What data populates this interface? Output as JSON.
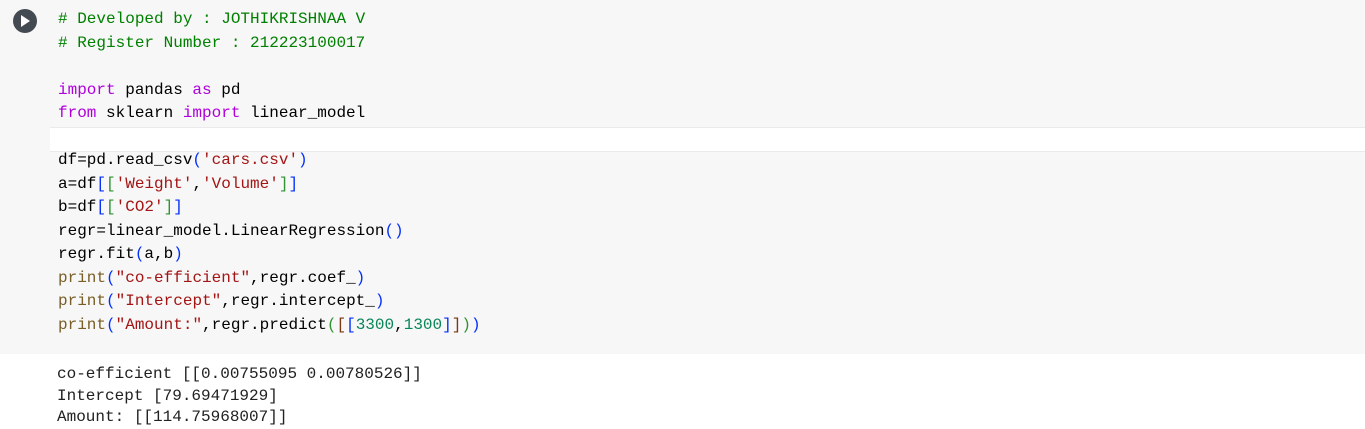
{
  "cell": {
    "run_button_icon": "play-icon",
    "code_lines": [
      [
        {
          "t": "# Developed by : JOTHIKRISHNAA V",
          "c": "cm"
        }
      ],
      [
        {
          "t": "# Register Number : 212223100017",
          "c": "cm"
        }
      ],
      [],
      [
        {
          "t": "import",
          "c": "kw"
        },
        {
          "t": " pandas "
        },
        {
          "t": "as",
          "c": "kw"
        },
        {
          "t": " pd"
        }
      ],
      [
        {
          "t": "from",
          "c": "kw"
        },
        {
          "t": " sklearn "
        },
        {
          "t": "import",
          "c": "kw"
        },
        {
          "t": " linear_model"
        }
      ],
      [],
      [
        {
          "t": "df=pd.read_csv"
        },
        {
          "t": "(",
          "c": "b1"
        },
        {
          "t": "'cars.csv'",
          "c": "st"
        },
        {
          "t": ")",
          "c": "b1"
        }
      ],
      [
        {
          "t": "a=df"
        },
        {
          "t": "[",
          "c": "b1"
        },
        {
          "t": "[",
          "c": "b2"
        },
        {
          "t": "'Weight'",
          "c": "st"
        },
        {
          "t": ","
        },
        {
          "t": "'Volume'",
          "c": "st"
        },
        {
          "t": "]",
          "c": "b2"
        },
        {
          "t": "]",
          "c": "b1"
        }
      ],
      [
        {
          "t": "b=df"
        },
        {
          "t": "[",
          "c": "b1"
        },
        {
          "t": "[",
          "c": "b2"
        },
        {
          "t": "'CO2'",
          "c": "st"
        },
        {
          "t": "]",
          "c": "b2"
        },
        {
          "t": "]",
          "c": "b1"
        }
      ],
      [
        {
          "t": "regr=linear_model.LinearRegression"
        },
        {
          "t": "()",
          "c": "b1"
        }
      ],
      [
        {
          "t": "regr.fit"
        },
        {
          "t": "(",
          "c": "b1"
        },
        {
          "t": "a,b"
        },
        {
          "t": ")",
          "c": "b1"
        }
      ],
      [
        {
          "t": "print",
          "c": "fn"
        },
        {
          "t": "(",
          "c": "b1"
        },
        {
          "t": "\"co-efficient\"",
          "c": "st"
        },
        {
          "t": ",regr.coef_"
        },
        {
          "t": ")",
          "c": "b1"
        }
      ],
      [
        {
          "t": "print",
          "c": "fn"
        },
        {
          "t": "(",
          "c": "b1"
        },
        {
          "t": "\"Intercept\"",
          "c": "st"
        },
        {
          "t": ",regr.intercept_"
        },
        {
          "t": ")",
          "c": "b1"
        }
      ],
      [
        {
          "t": "print",
          "c": "fn"
        },
        {
          "t": "(",
          "c": "b1"
        },
        {
          "t": "\"Amount:\"",
          "c": "st"
        },
        {
          "t": ",regr.predict"
        },
        {
          "t": "(",
          "c": "b2"
        },
        {
          "t": "[",
          "c": "b3"
        },
        {
          "t": "[",
          "c": "b1"
        },
        {
          "t": "3300",
          "c": "nm"
        },
        {
          "t": ","
        },
        {
          "t": "1300",
          "c": "nm"
        },
        {
          "t": "]",
          "c": "b1"
        },
        {
          "t": "]",
          "c": "b3"
        },
        {
          "t": ")",
          "c": "b2"
        },
        {
          "t": ")",
          "c": "b1"
        }
      ]
    ],
    "output_lines": [
      "co-efficient [[0.00755095 0.00780526]]",
      "Intercept [79.69471929]",
      "Amount: [[114.75968007]]"
    ]
  }
}
